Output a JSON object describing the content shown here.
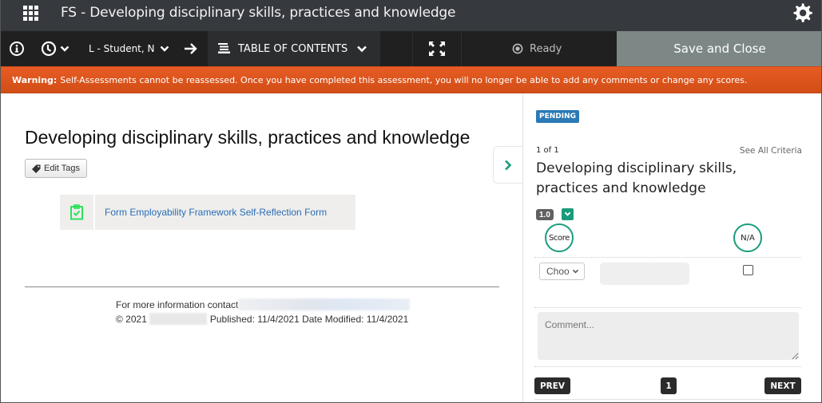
{
  "titlebar": {
    "apps_icon": "grid-apps-icon",
    "title": "FS - Developing disciplinary skills, practices and knowledge",
    "settings_icon": "gear-icon"
  },
  "toolbar": {
    "info_icon": "info-icon",
    "history_icon": "clock-icon",
    "student_label": "L - Student, N",
    "next_icon": "arrow-right-icon",
    "toc_label": "TABLE OF CONTENTS",
    "expand_icon": "expand-icon",
    "status_label": "Ready",
    "save_label": "Save and Close"
  },
  "warning": {
    "prefix": "Warning:",
    "message": "Self-Assessments cannot be reassessed. Once you have completed this assessment, you will no longer be able to add any comments or change any scores."
  },
  "main": {
    "title": "Developing disciplinary skills, practices and knowledge",
    "edit_tags_label": "Edit Tags",
    "form_link": "Form Employability Framework Self-Reflection Form",
    "footer": {
      "contact_prefix": "For more information contact",
      "copyright": "© 2021",
      "dates": "Published: 11/4/2021 Date Modified: 11/4/2021"
    }
  },
  "panel": {
    "status_badge": "PENDING",
    "count": "1 of 1",
    "see_all": "See All Criteria",
    "criterion_title": "Developing disciplinary skills, practices and knowledge",
    "weight": "1.0",
    "score_header": "Score",
    "na_header": "N/A",
    "score_select_value": "Choo",
    "na_checked": false,
    "comment_placeholder": "Comment...",
    "comment_value": "",
    "prev_label": "PREV",
    "page": "1",
    "next_label": "NEXT"
  },
  "colors": {
    "titlebar_bg": "#36393e",
    "toolbar_bg": "#202020",
    "save_bg": "#7c8786",
    "warning_bg": "#e0561d",
    "accent_teal": "#1a9c7c",
    "pending_blue": "#2a7ab5",
    "link_blue": "#2a6db7"
  }
}
